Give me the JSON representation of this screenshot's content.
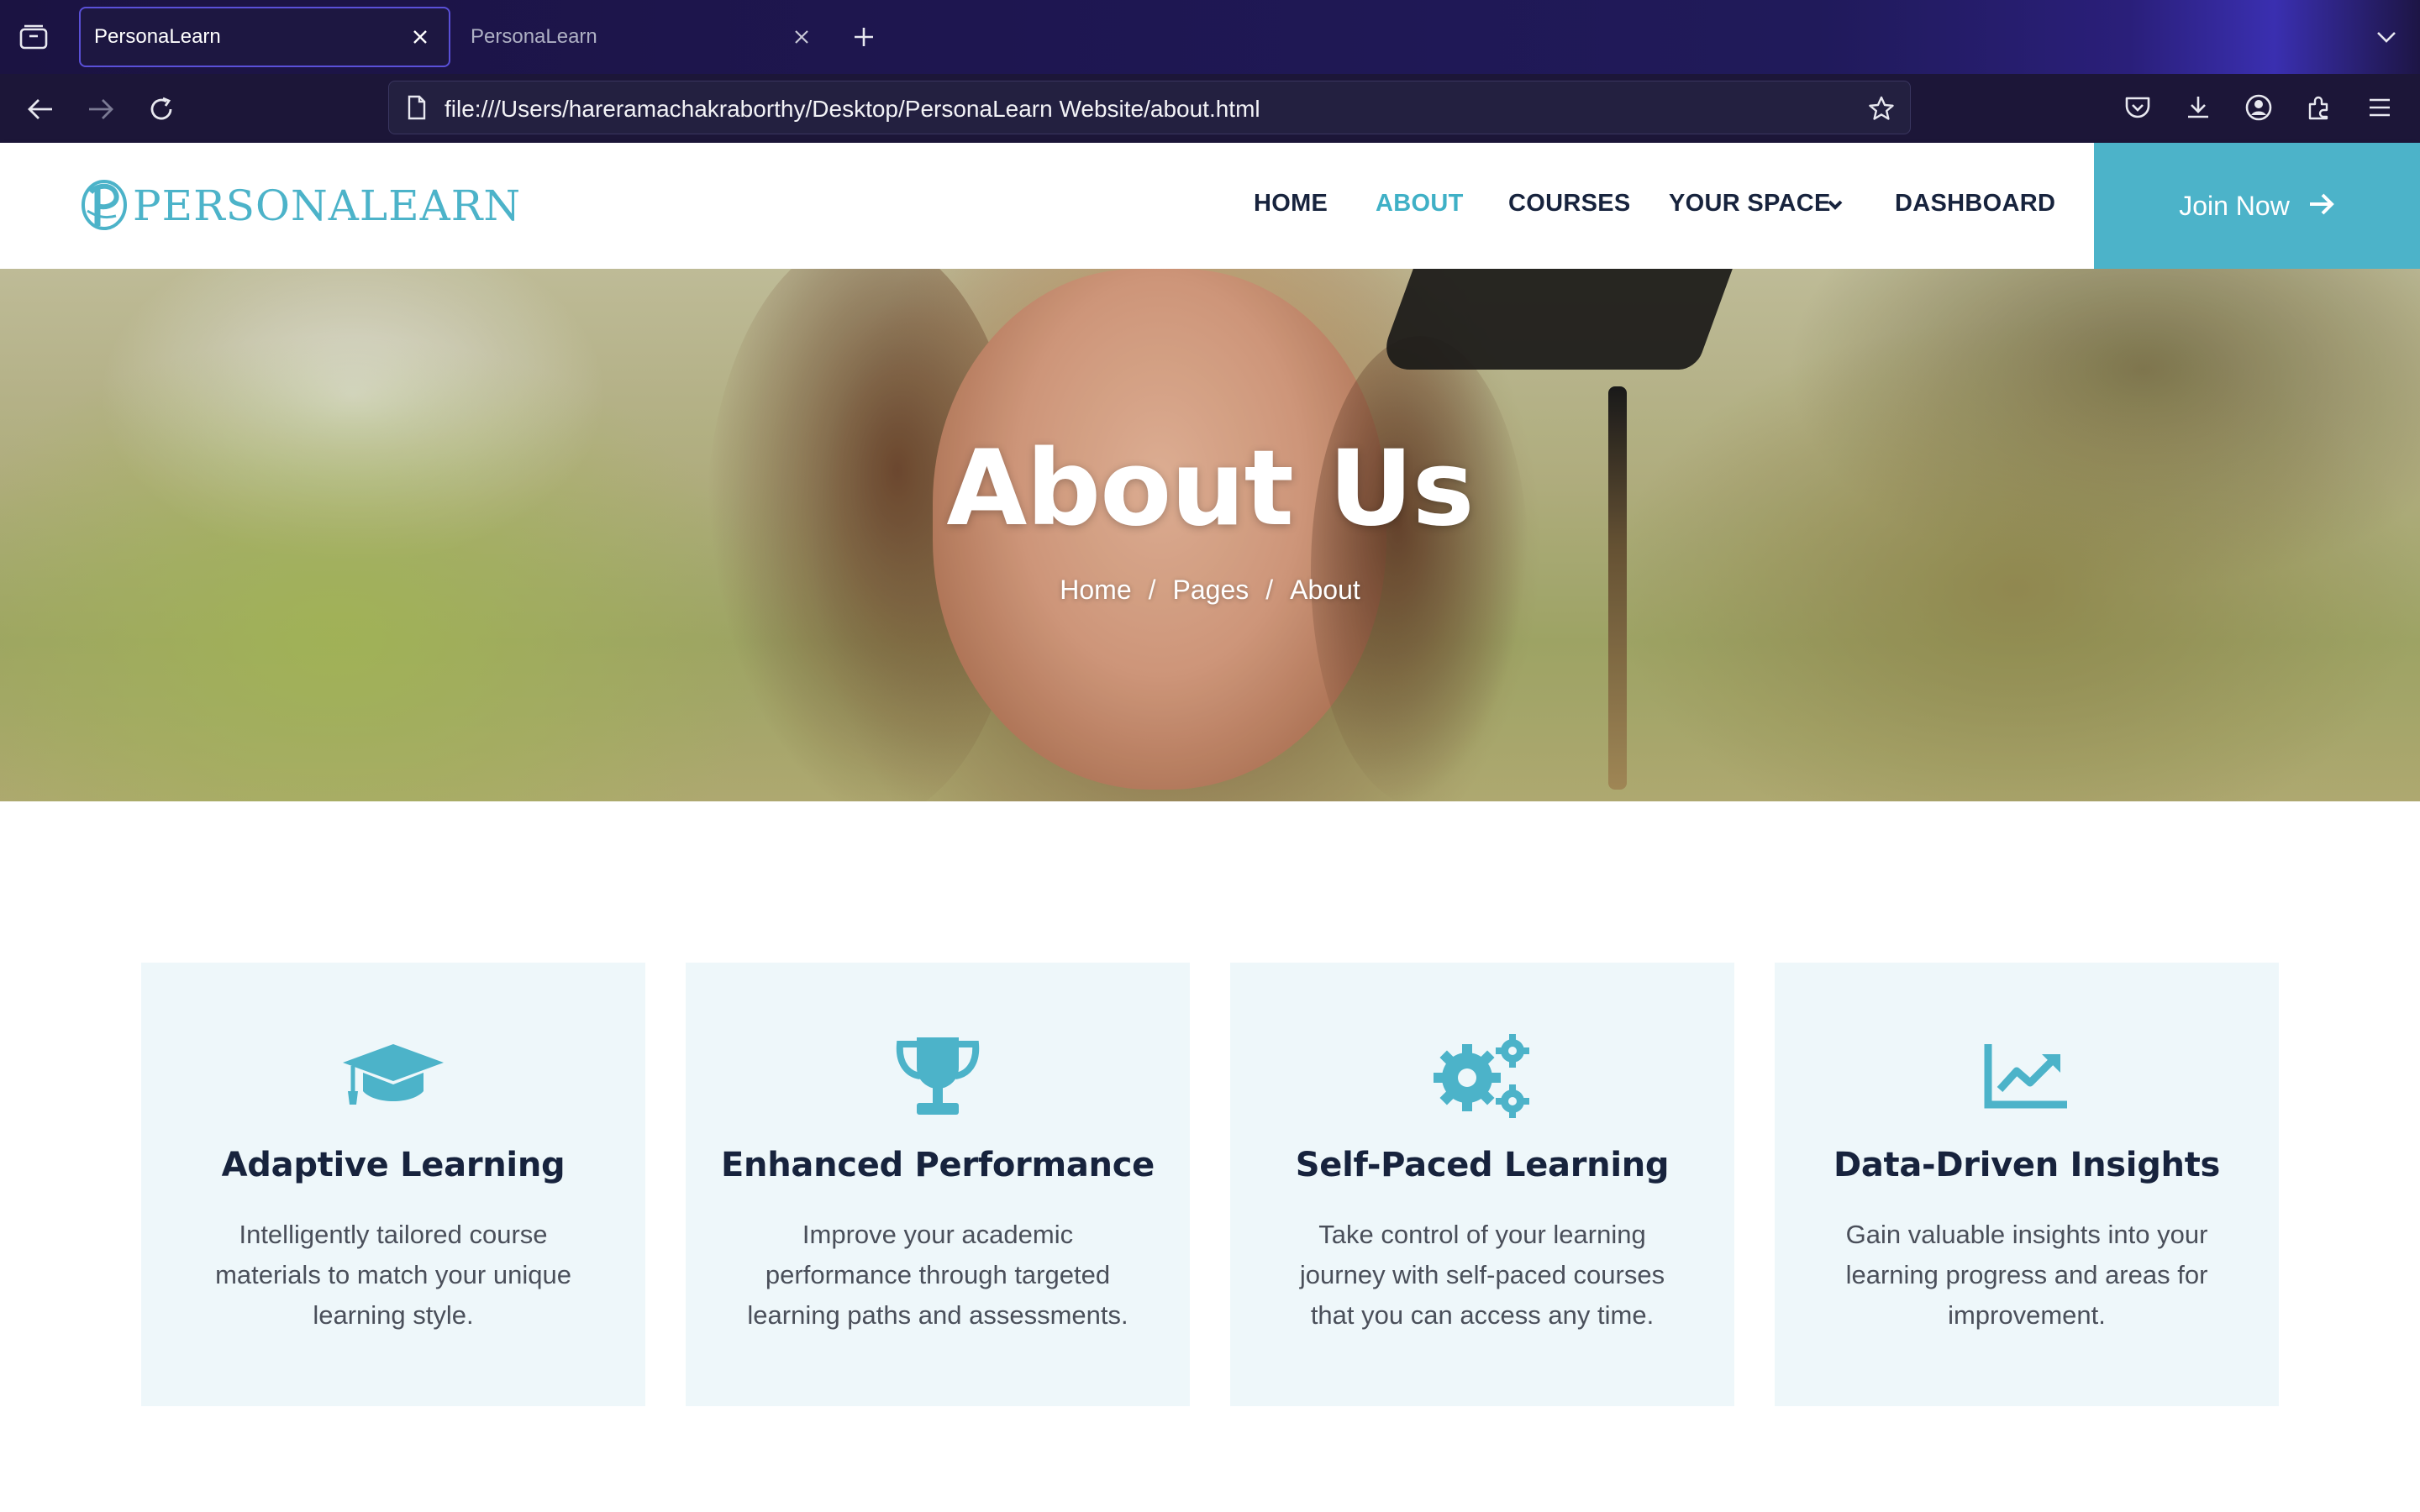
{
  "browser": {
    "tabs": [
      {
        "title": "PersonaLearn",
        "active": true
      },
      {
        "title": "PersonaLearn",
        "active": false
      }
    ],
    "url": "file:///Users/hareramachakraborthy/Desktop/PersonaLearn Website/about.html",
    "icons": [
      "tab-overview-icon",
      "close-icon",
      "plus-icon",
      "chevron-down-icon",
      "back-arrow-icon",
      "forward-arrow-icon",
      "reload-icon",
      "page-icon",
      "star-icon",
      "pocket-icon",
      "download-icon",
      "account-icon",
      "extensions-icon",
      "menu-icon"
    ]
  },
  "site": {
    "logo": {
      "text": "PERSONALEARN",
      "color": "#4cb3c9"
    },
    "menu": {
      "home": "HOME",
      "about": "ABOUT",
      "courses": "COURSES",
      "your_space": "YOUR SPACE",
      "dashboard": "DASHBOARD"
    },
    "join_label": "Join Now",
    "accent_color": "#4cb3c9"
  },
  "hero": {
    "title": "About Us",
    "breadcrumb": {
      "home": "Home",
      "separator": "/",
      "pages": "Pages",
      "current": "About"
    }
  },
  "features": [
    {
      "icon": "graduation-cap-icon",
      "title": "Adaptive Learning",
      "description": "Intelligently tailored course materials to match your unique learning style."
    },
    {
      "icon": "trophy-icon",
      "title": "Enhanced Performance",
      "description": "Improve your academic performance through targeted learning paths and assessments."
    },
    {
      "icon": "gears-icon",
      "title": "Self-Paced Learning",
      "description": "Take control of your learning journey with self-paced courses that you can access any time."
    },
    {
      "icon": "chart-line-icon",
      "title": "Data-Driven Insights",
      "description": "Gain valuable insights into your learning progress and areas for improvement."
    }
  ]
}
